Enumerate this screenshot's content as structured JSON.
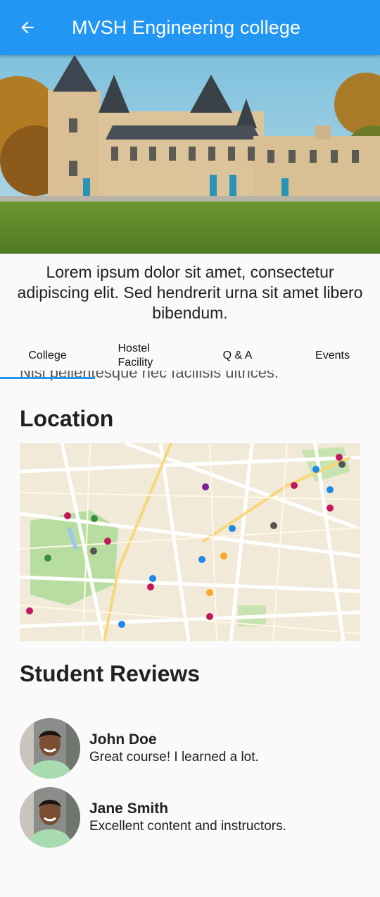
{
  "appbar": {
    "title": "MVSH Engineering college",
    "back_icon": "arrow-back-icon",
    "color": "#2196f3"
  },
  "hero": {
    "image": "college-castle-building-photo"
  },
  "description": "Lorem ipsum dolor sit amet, consectetur adipiscing elit. Sed hendrerit urna sit amet libero bibendum.",
  "tabs": [
    {
      "label": "College",
      "selected": true
    },
    {
      "label": "Hostel Facility",
      "selected": false
    },
    {
      "label": "Q & A",
      "selected": false
    },
    {
      "label": "Events",
      "selected": false
    }
  ],
  "clipped_text": "Nisi pellentesque nec facilisis ultrices.",
  "location": {
    "title": "Location",
    "map": "city-street-map"
  },
  "reviews": {
    "title": "Student Reviews",
    "items": [
      {
        "name": "John Doe",
        "text": "Great course! I learned a lot."
      },
      {
        "name": "Jane Smith",
        "text": "Excellent content and instructors."
      }
    ]
  }
}
